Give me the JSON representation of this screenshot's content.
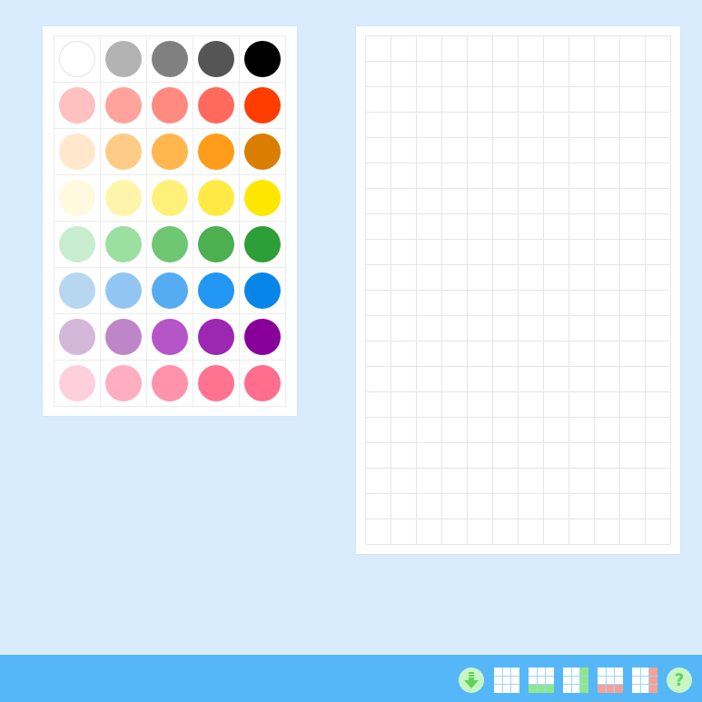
{
  "palette": {
    "rows": [
      [
        "#ffffff",
        "#b3b3b3",
        "#808080",
        "#555555",
        "#000000"
      ],
      [
        "#ffc0c0",
        "#ffa39c",
        "#ff8a80",
        "#ff6a5c",
        "#ff3d00"
      ],
      [
        "#ffe8cc",
        "#ffcc88",
        "#ffb74d",
        "#ff9c1a",
        "#d97e00"
      ],
      [
        "#fff9df",
        "#fff5aa",
        "#fff07a",
        "#ffea45",
        "#ffe600"
      ],
      [
        "#c8edce",
        "#9ae09f",
        "#6fc673",
        "#4caf50",
        "#2e9e36"
      ],
      [
        "#b7d7f0",
        "#92c6f2",
        "#55acf0",
        "#2196f3",
        "#0885e8"
      ],
      [
        "#d3b8da",
        "#be86c9",
        "#b655c7",
        "#9c27b0",
        "#880099"
      ],
      [
        "#ffcfdb",
        "#ffadc0",
        "#ff93ab",
        "#ff7391",
        "#ff6e8c"
      ]
    ]
  },
  "board": {
    "columns": 12,
    "rows": 20
  },
  "toolbar": {
    "accent": "#56b7f8",
    "tools": [
      {
        "name": "download-icon"
      },
      {
        "name": "grid-plain-icon"
      },
      {
        "name": "grid-add-row-icon"
      },
      {
        "name": "grid-add-column-icon"
      },
      {
        "name": "grid-remove-row-icon"
      },
      {
        "name": "grid-remove-column-icon"
      },
      {
        "name": "help-icon",
        "glyph": "?"
      }
    ]
  }
}
